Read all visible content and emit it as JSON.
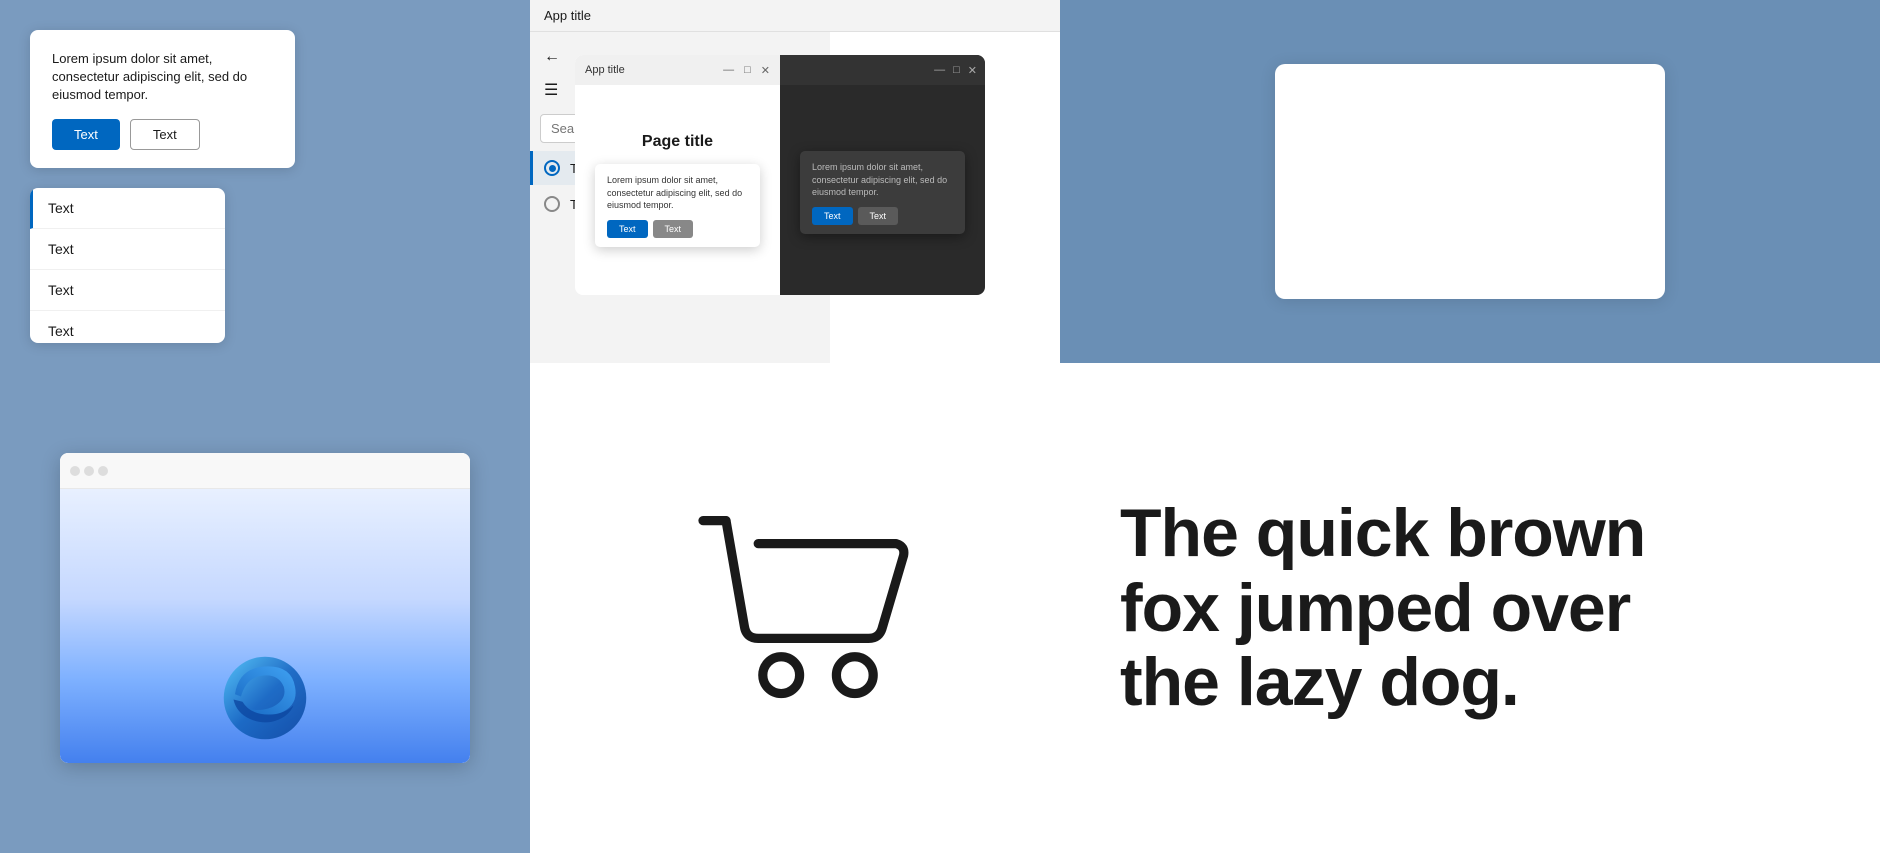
{
  "dialog": {
    "text": "Lorem ipsum dolor sit amet, consectetur adipiscing elit, sed do eiusmod tempor.",
    "btn_primary": "Text",
    "btn_secondary": "Text"
  },
  "list": {
    "items": [
      {
        "label": "Text",
        "active": true
      },
      {
        "label": "Text",
        "active": false
      },
      {
        "label": "Text",
        "active": false
      },
      {
        "label": "Text",
        "active": false
      }
    ]
  },
  "nav": {
    "app_title": "App title",
    "back_icon": "←",
    "hamburger_icon": "☰",
    "search_placeholder": "Search",
    "items": [
      {
        "label": "Text",
        "active": true
      },
      {
        "label": "Text",
        "active": false
      }
    ]
  },
  "page": {
    "title": "Page title"
  },
  "window": {
    "title": "App title",
    "page_title": "Page title",
    "dialog_text": "Lorem ipsum dolor sit amet, consectetur adipiscing elit, sed do eiusmod tempor.",
    "btn_primary": "Text",
    "btn_secondary": "Text"
  },
  "big_text": {
    "line1": "The quick brown",
    "line2": "fox jumped over",
    "line3": "the lazy dog."
  },
  "colors": {
    "accent": "#0067c0",
    "bg": "#7a9bbf",
    "dark_bg": "#2a2a2a"
  }
}
